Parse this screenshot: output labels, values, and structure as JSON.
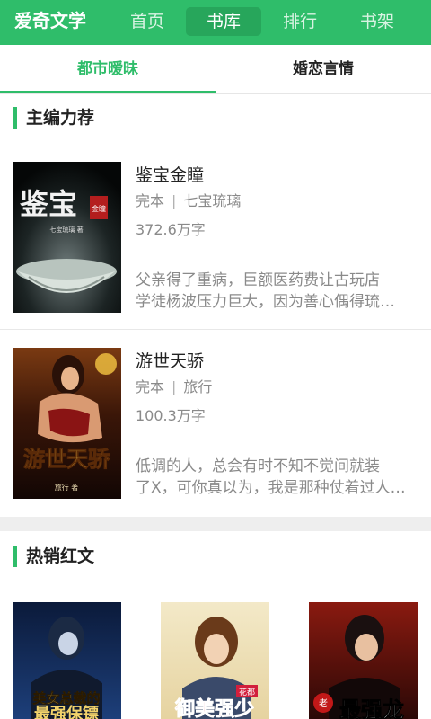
{
  "app": {
    "logo": "爱奇文学"
  },
  "nav": {
    "items": [
      {
        "label": "首页"
      },
      {
        "label": "书库"
      },
      {
        "label": "排行"
      },
      {
        "label": "书架"
      }
    ],
    "active": "书库"
  },
  "subtabs": [
    {
      "label": "都市暧昧"
    },
    {
      "label": "婚恋言情"
    }
  ],
  "sections": {
    "recommend": {
      "title": "主编力荐"
    },
    "hot": {
      "title": "热销红文"
    }
  },
  "books": [
    {
      "title": "鉴宝金瞳",
      "status": "完本",
      "author": "七宝琉璃",
      "words": "372.6万字",
      "desc_line1": "父亲得了重病，巨额医药费让古玩店",
      "desc_line2": "学徒杨波压力巨大，因为善心偶得琉…",
      "cover_title": "鉴宝",
      "cover_badge": "金瞳",
      "cover_author": "七宝琉璃 著"
    },
    {
      "title": "游世天骄",
      "status": "完本",
      "author": "旅行",
      "words": "100.3万字",
      "desc_line1": "低调的人，总会有时不知不觉间就装",
      "desc_line2": "了X，可你真以为，我是那种仗着过人…",
      "cover_title": "游世天骄",
      "cover_author": "旅行 著"
    }
  ],
  "hot_covers": [
    {
      "cover_title": "美女总裁的",
      "cover_title2": "最强保镖"
    },
    {
      "cover_title": "御美强少",
      "cover_badge": "花都"
    },
    {
      "cover_title": "最强龙",
      "cover_badge": "老"
    }
  ],
  "colors": {
    "accent": "#2fbd6a",
    "nav_active": "#27a65b"
  }
}
